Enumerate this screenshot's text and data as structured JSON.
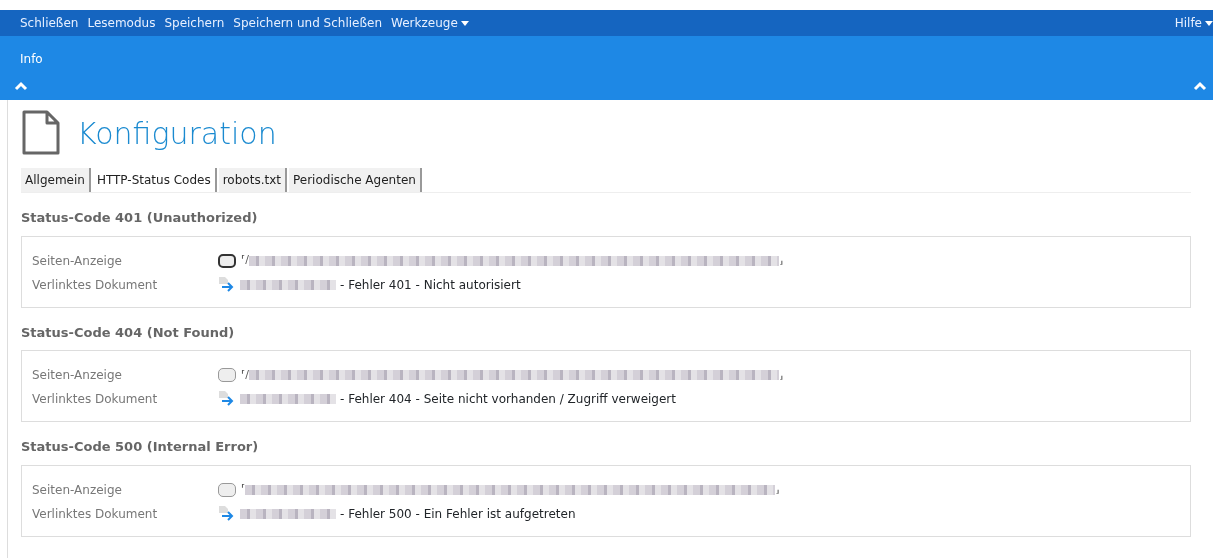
{
  "menu": {
    "items": [
      "Schließen",
      "Lesemodus",
      "Speichern",
      "Speichern und Schließen"
    ],
    "dropdown": "Werkzeuge",
    "help": "Hilfe"
  },
  "info_band": {
    "label": "Info",
    "expanded": true
  },
  "page": {
    "title": "Konfiguration"
  },
  "tabs": [
    {
      "label": "Allgemein",
      "selected": false
    },
    {
      "label": "HTTP-Status Codes",
      "selected": true
    },
    {
      "label": "robots.txt",
      "selected": false
    },
    {
      "label": "Periodische Agenten",
      "selected": false
    }
  ],
  "sections": [
    {
      "heading": "Status-Code 401 (Unauthorized)",
      "page_label": "Seiten-Anzeige",
      "page_focused": true,
      "page_prefix": "⸢/",
      "page_suffix": "⸥",
      "doc_label": "Verlinktes Dokument",
      "doc_text": "- Fehler 401 - Nicht autorisiert"
    },
    {
      "heading": "Status-Code 404 (Not Found)",
      "page_label": "Seiten-Anzeige",
      "page_focused": false,
      "page_prefix": "⸢/",
      "page_suffix": "⸥",
      "doc_label": "Verlinktes Dokument",
      "doc_text": "- Fehler 404 - Seite nicht vorhanden / Zugriff verweigert"
    },
    {
      "heading": "Status-Code 500 (Internal Error)",
      "page_label": "Seiten-Anzeige",
      "page_focused": false,
      "page_prefix": "⸢",
      "page_suffix": "⸥",
      "doc_label": "Verlinktes Dokument",
      "doc_text": "- Fehler 500 - Ein Fehler ist aufgetreten"
    }
  ]
}
